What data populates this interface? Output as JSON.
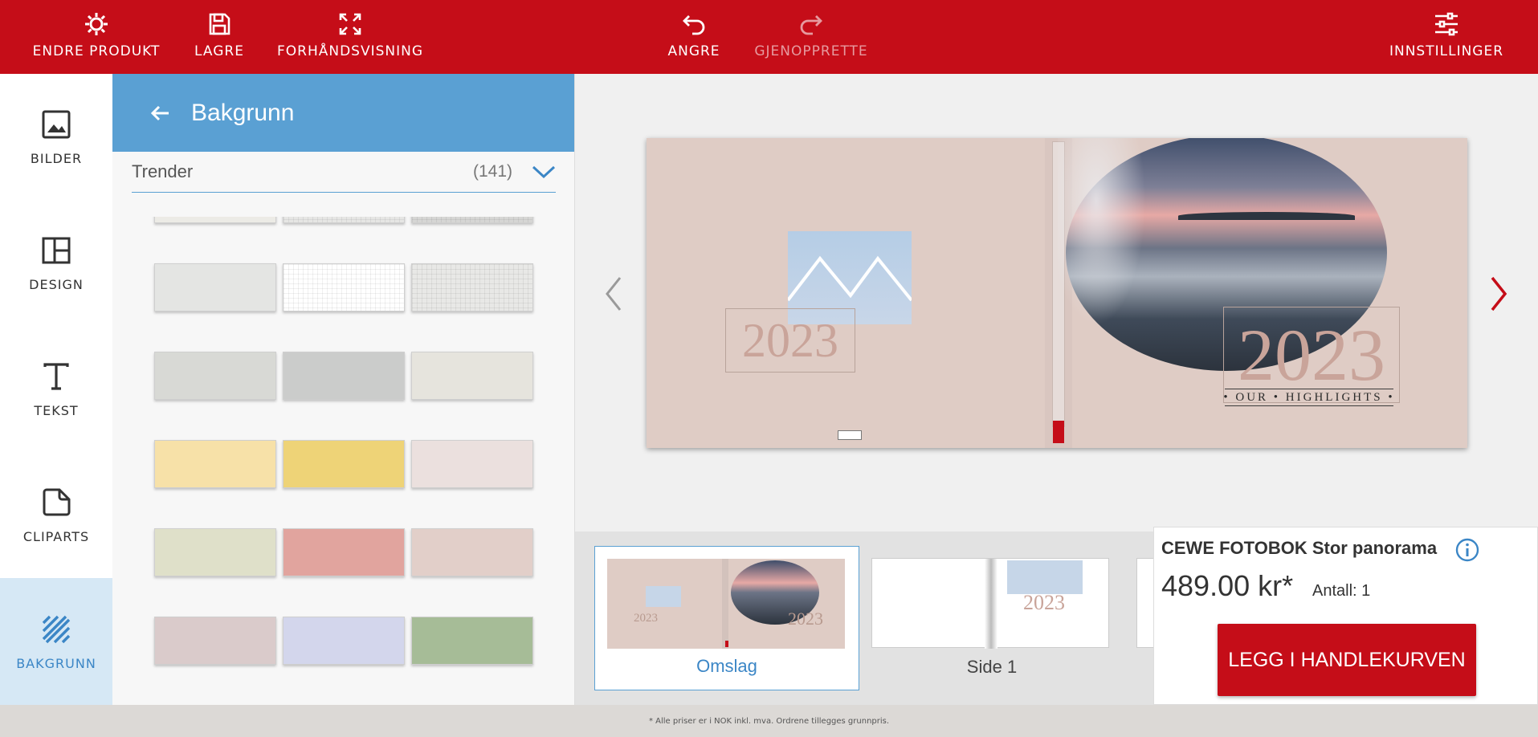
{
  "topbar": {
    "change_product": "ENDRE PRODUKT",
    "save": "LAGRE",
    "preview": "FORHÅNDSVISNING",
    "undo": "ANGRE",
    "redo": "GJENOPPRETTE",
    "settings": "INNSTILLINGER"
  },
  "rail": {
    "images": "BILDER",
    "design": "DESIGN",
    "text": "TEKST",
    "cliparts": "CLIPARTS",
    "background": "BAKGRUNN"
  },
  "panel": {
    "title": "Bakgrunn",
    "filter_name": "Trender",
    "filter_count": "(141)",
    "swatches": [
      [
        "#ecebe6",
        "#e6e6e4",
        "#d6d6d4"
      ],
      [
        "#e4e5e3",
        "#ffffff",
        "#e8e8e6"
      ],
      [
        "#d8d9d5",
        "#cbcccb",
        "#e6e4dd"
      ],
      [
        "#f7e1a8",
        "#eed377",
        "#ebe0de"
      ],
      [
        "#dfe0c9",
        "#e1a49e",
        "#e2cfc9"
      ],
      [
        "#dacbcb",
        "#d3d6ec",
        "#a6bc97"
      ]
    ]
  },
  "cover": {
    "year_left": "2023",
    "year_right": "2023",
    "highlights": "• OUR • HIGHLIGHTS •"
  },
  "thumbnails": {
    "cover_label": "Omslag",
    "page1_label": "Side 1",
    "mini_year": "2023"
  },
  "pricebox": {
    "title": "CEWE FOTOBOK Stor panorama",
    "price": "489.00 kr*",
    "quantity": "Antall: 1",
    "cart_button": "LEGG I HANDLEKURVEN"
  },
  "footer": {
    "note": "* Alle priser er i NOK inkl. mva. Ordrene tillegges grunnpris."
  },
  "colors": {
    "brand_red": "#c50d18",
    "accent_blue": "#5aa0d3",
    "active_rail_bg": "#d6e8f5"
  }
}
